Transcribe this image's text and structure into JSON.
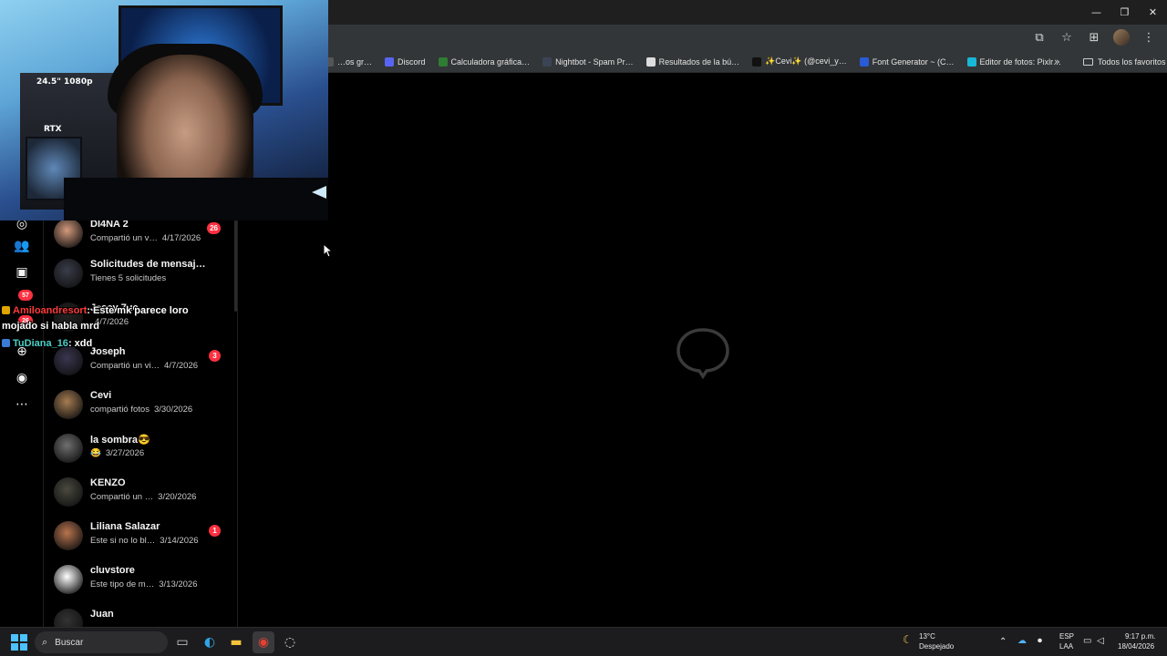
{
  "window_controls": {
    "minimize": "—",
    "restore": "❐",
    "close": "✕"
  },
  "bookmarks": [
    {
      "label": "…os gr…",
      "icon": "bookmark-generic-icon",
      "color": "#555"
    },
    {
      "label": "Discord",
      "icon": "discord-icon",
      "color": "#5865f2"
    },
    {
      "label": "Calculadora gráfica…",
      "icon": "desmos-icon",
      "color": "#2f7d32"
    },
    {
      "label": "Nightbot - Spam Pr…",
      "icon": "nightbot-icon",
      "color": "#3b4454"
    },
    {
      "label": "Resultados de la bú…",
      "icon": "document-icon",
      "color": "#dddddd"
    },
    {
      "label": "✨Cevi✨ (@cevi_y…",
      "icon": "tiktok-icon",
      "color": "#111111"
    },
    {
      "label": "Font Generator ~ (C…",
      "icon": "font-generator-icon",
      "color": "#2a5bd7"
    },
    {
      "label": "Editor de fotos: Pixlr…",
      "icon": "pixlr-icon",
      "color": "#19b7d6"
    }
  ],
  "bookmarks_more": "»",
  "bookmarks_folder_label": "Todos los favoritos",
  "webcam": {
    "monitor_label": "24.5\" 1080p",
    "case_label": "RTX"
  },
  "rail": {
    "badge_notifications": "57",
    "badge_messages": "26"
  },
  "conversations": [
    {
      "name": "DI4NA 2",
      "preview": "Compartió un v…",
      "date": "4/17/2026",
      "badge": "26",
      "avatar_color": "#d49a7c"
    },
    {
      "name": "Solicitudes de mensaj…",
      "preview": "Tienes 5 solicitudes",
      "date": "",
      "badge": "",
      "avatar_color": "#3a3d4a"
    },
    {
      "name": "Jesey 7ue",
      "preview": "",
      "date": "4/7/2026",
      "badge": "",
      "avatar_color": "#222222"
    },
    {
      "name": "Ɉoseph",
      "preview": "Compartió un vi…",
      "date": "4/7/2026",
      "badge": "3",
      "avatar_color": "#3a3550"
    },
    {
      "name": "Cevi",
      "preview": "compartió fotos",
      "date": "3/30/2026",
      "badge": "",
      "avatar_color": "#a67c52"
    },
    {
      "name": "la sombra😎",
      "preview": "😂",
      "date": "3/27/2026",
      "badge": "",
      "avatar_color": "#6f6f6f"
    },
    {
      "name": "KENZO",
      "preview": "Compartió un …",
      "date": "3/20/2026",
      "badge": "",
      "avatar_color": "#4a4a40"
    },
    {
      "name": "Liliana Salazar",
      "preview": "Este si no lo bl…",
      "date": "3/14/2026",
      "badge": "1",
      "avatar_color": "#b8744e"
    },
    {
      "name": "cluvstore",
      "preview": "Este tipo de m…",
      "date": "3/13/2026",
      "badge": "",
      "avatar_color": "#ffffff"
    },
    {
      "name": "Juan",
      "preview": "",
      "date": "",
      "badge": "",
      "avatar_color": "#333333"
    }
  ],
  "chat": [
    {
      "user": "Amiloandresort",
      "message": ": Este mk parece loro",
      "user_color": "#ff3b3b"
    },
    {
      "user": "",
      "message": "mojado si habla mrd",
      "user_color": "#ffffff"
    },
    {
      "user": "TuDiana_16",
      "message": ": xdd",
      "user_color": "#4ad1c8"
    }
  ],
  "taskbar": {
    "search_placeholder": "Buscar",
    "weather_temp": "13°C",
    "weather_desc": "Despejado",
    "lang_top": "ESP",
    "lang_bottom": "LAA",
    "time": "9:17 p.m.",
    "date": "18/04/2026"
  }
}
